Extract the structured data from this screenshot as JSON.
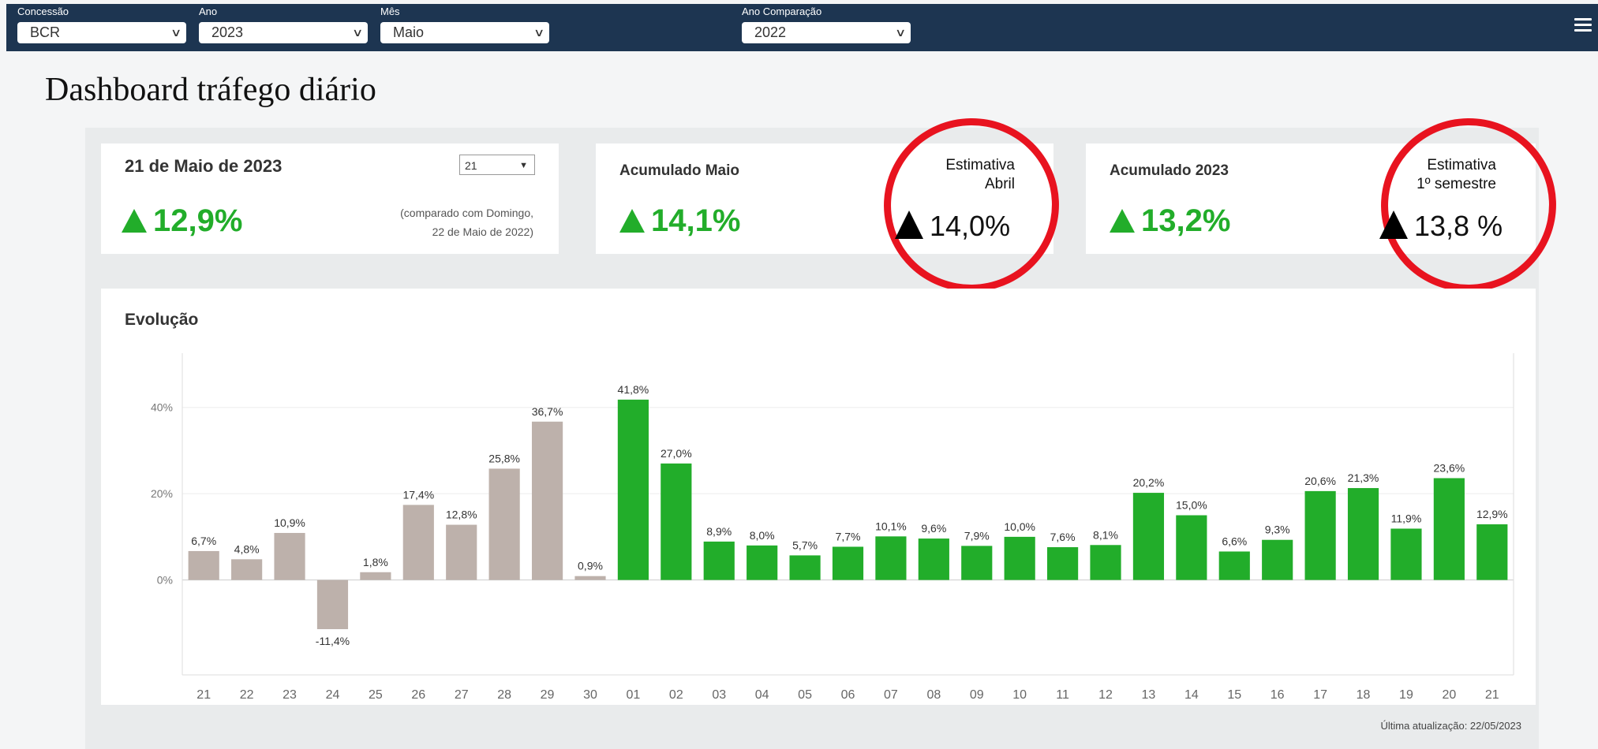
{
  "filters": [
    {
      "label": "Concessão",
      "value": "BCR"
    },
    {
      "label": "Ano",
      "value": "2023"
    },
    {
      "label": "Mês",
      "value": "Maio"
    },
    {
      "label": "Ano Comparação",
      "value": "2022"
    }
  ],
  "page_title": "Dashboard tráfego diário",
  "day_card": {
    "title": "21 de Maio de 2023",
    "day_select": "21",
    "pct": "12,9%",
    "compare_line1": "(comparado com Domingo,",
    "compare_line2": "22 de Maio de 2022)"
  },
  "month_card": {
    "title": "Acumulado Maio",
    "pct": "14,1%",
    "estimate_line1": "Estimativa",
    "estimate_line2": "Abril",
    "estimate_value": "14,0%"
  },
  "year_card": {
    "title": "Acumulado 2023",
    "pct": "13,2%",
    "estimate_line1": "Estimativa",
    "estimate_line2": "1º semestre",
    "estimate_value": "13,8 %"
  },
  "colors": {
    "up": "#22ad2a",
    "previous_month": "#bdb1ab",
    "ring": "#e8131f",
    "topbar": "#1d3551"
  },
  "chart_data": {
    "type": "bar",
    "title": "Evolução",
    "categories": [
      "21",
      "22",
      "23",
      "24",
      "25",
      "26",
      "27",
      "28",
      "29",
      "30",
      "01",
      "02",
      "03",
      "04",
      "05",
      "06",
      "07",
      "08",
      "09",
      "10",
      "11",
      "12",
      "13",
      "14",
      "15",
      "16",
      "17",
      "18",
      "19",
      "20",
      "21"
    ],
    "values": [
      6.7,
      4.8,
      10.9,
      -11.4,
      1.8,
      17.4,
      12.8,
      25.8,
      36.7,
      0.9,
      41.8,
      27.0,
      8.9,
      8.0,
      5.7,
      7.7,
      10.1,
      9.6,
      7.9,
      10.0,
      7.6,
      8.1,
      20.2,
      15.0,
      6.6,
      9.3,
      20.6,
      21.3,
      11.9,
      23.6,
      12.9
    ],
    "labels": [
      "6,7%",
      "4,8%",
      "10,9%",
      "-11,4%",
      "1,8%",
      "17,4%",
      "12,8%",
      "25,8%",
      "36,7%",
      "0,9%",
      "41,8%",
      "27,0%",
      "8,9%",
      "8,0%",
      "5,7%",
      "7,7%",
      "10,1%",
      "9,6%",
      "7,9%",
      "10,0%",
      "7,6%",
      "8,1%",
      "20,2%",
      "15,0%",
      "6,6%",
      "9,3%",
      "20,6%",
      "21,3%",
      "11,9%",
      "23,6%",
      "12,9%"
    ],
    "series_split_index": 10,
    "yticks": [
      "0%",
      "20%",
      "40%"
    ],
    "ytick_values": [
      0,
      20,
      40
    ],
    "ylim": [
      -22,
      50
    ],
    "grid": true,
    "xlabel": "",
    "ylabel": ""
  },
  "footer": "Última atualização: 22/05/2023"
}
